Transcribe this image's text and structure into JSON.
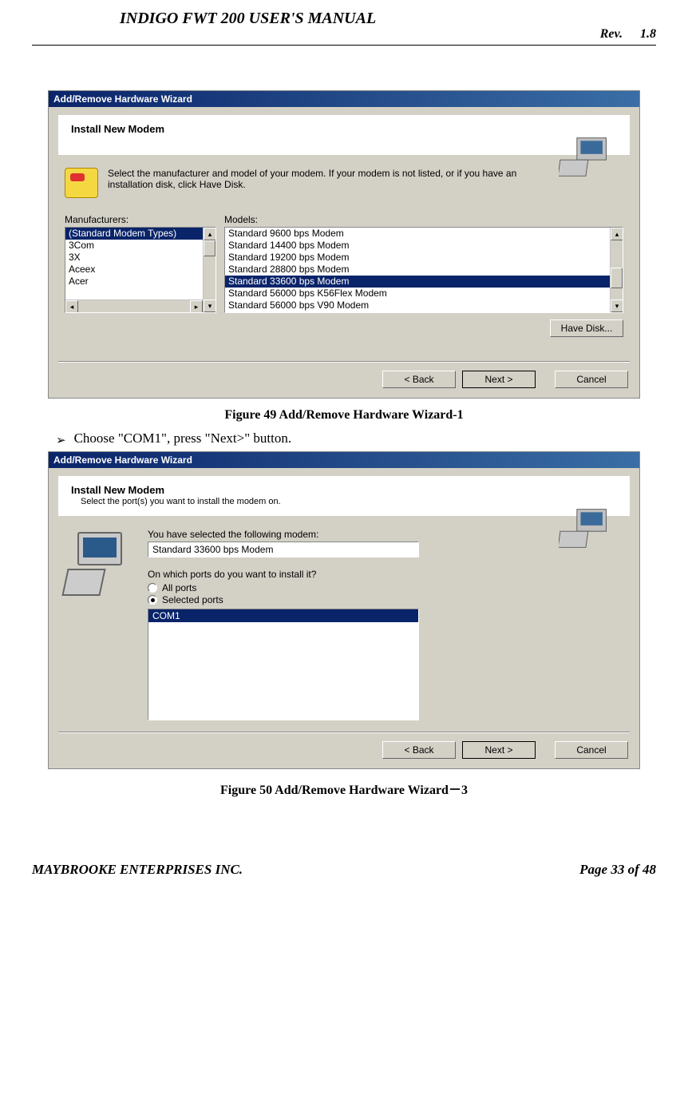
{
  "header": {
    "title": "INDIGO FWT 200 USER'S MANUAL",
    "rev_label": "Rev.",
    "rev_value": "1.8"
  },
  "dialog1": {
    "title": "Add/Remove Hardware Wizard",
    "heading": "Install New Modem",
    "instruction": "Select the manufacturer and model of your modem. If your modem is not listed, or if you have an installation disk, click Have Disk.",
    "label_manufacturers": "Manufacturers:",
    "label_models": "Models:",
    "manufacturers": [
      "(Standard Modem Types)",
      "3Com",
      "3X",
      "Aceex",
      "Acer"
    ],
    "manufacturers_selected_index": 0,
    "models": [
      "Standard  9600 bps Modem",
      "Standard 14400 bps Modem",
      "Standard 19200 bps Modem",
      "Standard 28800 bps Modem",
      "Standard 33600 bps Modem",
      "Standard 56000 bps K56Flex Modem",
      "Standard 56000 bps V90 Modem"
    ],
    "models_selected_index": 4,
    "btn_have_disk": "Have Disk...",
    "btn_back": "< Back",
    "btn_next": "Next >",
    "btn_cancel": "Cancel"
  },
  "caption1": "Figure 49 Add/Remove Hardware Wizard-1",
  "bullet1": "Choose \"COM1\", press \"Next>\" button.",
  "dialog2": {
    "title": "Add/Remove Hardware Wizard",
    "heading": "Install New Modem",
    "subheading": "Select the port(s) you want to install the modem on.",
    "selected_label": "You have selected the following modem:",
    "selected_modem": "Standard 33600 bps Modem",
    "ports_question": "On which ports do you want to install it?",
    "radio_all": "All ports",
    "radio_selected": "Selected ports",
    "ports": [
      "COM1"
    ],
    "ports_selected_index": 0,
    "btn_back": "< Back",
    "btn_next": "Next >",
    "btn_cancel": "Cancel"
  },
  "caption2": "Figure 50 Add/Remove Hardware Wizard－3",
  "footer": {
    "company": "MAYBROOKE ENTERPRISES INC.",
    "page": "Page 33 of 48"
  }
}
